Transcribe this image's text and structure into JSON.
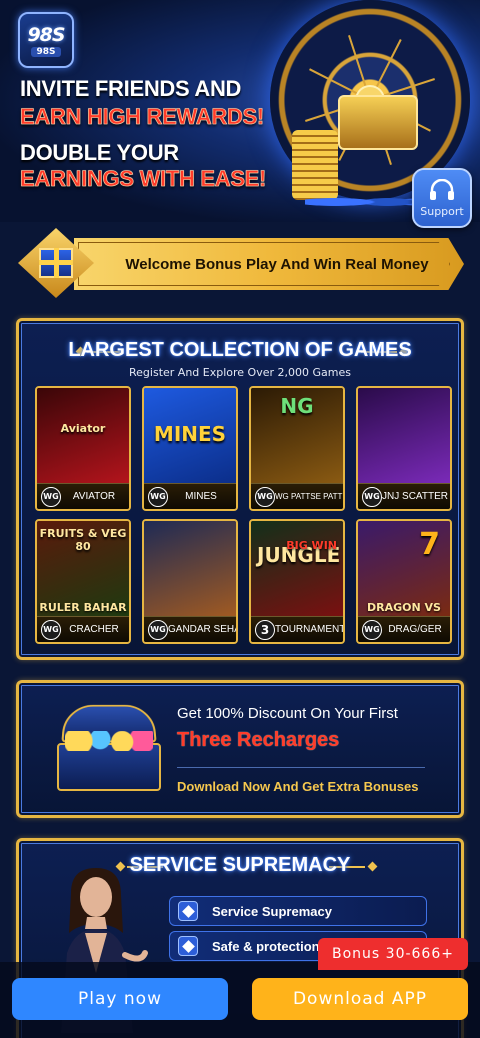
{
  "brand": {
    "logo_text": "98S",
    "logo_sub": "98S"
  },
  "hero": {
    "line1": "INVITE FRIENDS AND",
    "line2": "EARN HIGH REWARDS!",
    "line3": "DOUBLE YOUR",
    "line4": "EARNINGS WITH EASE!"
  },
  "support": {
    "label": "Support",
    "icon": "headset-icon"
  },
  "welcome": {
    "text": "Welcome Bonus Play And Win Real Money",
    "icon": "gift-icon"
  },
  "games_section": {
    "title": "LARGEST COLLECTION OF GAMES",
    "subtitle": "Register And Explore Over 2,000 Games",
    "games": [
      {
        "name": "AVIATOR",
        "badge": "WG",
        "art_text": "Aviator",
        "colors": [
          "#3a0608",
          "#b3141c"
        ]
      },
      {
        "name": "MINES",
        "badge": "WG",
        "art_text": "MINES",
        "colors": [
          "#1e5ae0",
          "#0b2e8a"
        ]
      },
      {
        "name": "WG PATTSE PATTI",
        "badge": "WG",
        "art_text": "NG",
        "colors": [
          "#2b1a05",
          "#8a5a12"
        ]
      },
      {
        "name": "JNJ SCATTER",
        "badge": "WG",
        "art_text": "",
        "colors": [
          "#2a0b4a",
          "#7a2ab8"
        ]
      },
      {
        "name": "CRACHER",
        "badge": "WG",
        "art_text": "FRUITS & VEG 80",
        "art_text2": "RULER BAHAR",
        "colors": [
          "#5a1a0c",
          "#1e3a10"
        ]
      },
      {
        "name": "GANDAR SEHAR",
        "badge": "WG",
        "art_text": "",
        "colors": [
          "#1e2a55",
          "#a05a22"
        ]
      },
      {
        "name": "TOURNAMENT",
        "badge": "3",
        "art_text": "JUNGLE",
        "art_text2": "BIG WIN",
        "colors": [
          "#12301a",
          "#7a1010"
        ]
      },
      {
        "name": "DRAG/GER",
        "badge": "WG",
        "art_text": "7",
        "art_text2": "DRAGON VS TIGER",
        "colors": [
          "#3a1a6a",
          "#7a2a12"
        ]
      }
    ]
  },
  "discount": {
    "line1": "Get 100% Discount On Your First",
    "line2": "Three Recharges",
    "line3": "Download Now And Get Extra Bonuses"
  },
  "service": {
    "title": "SERVICE SUPREMACY",
    "items": [
      {
        "label": "Service Supremacy"
      },
      {
        "label": "Safe & protection"
      }
    ]
  },
  "bottom": {
    "play_label": "Play now",
    "download_label": "Download APP",
    "bonus_label": "Bonus 30-666+"
  },
  "colors": {
    "gold": "#e6b642",
    "play_blue": "#2f87ff",
    "download_orange": "#ffb31a",
    "bonus_red": "#ee2e2e"
  }
}
